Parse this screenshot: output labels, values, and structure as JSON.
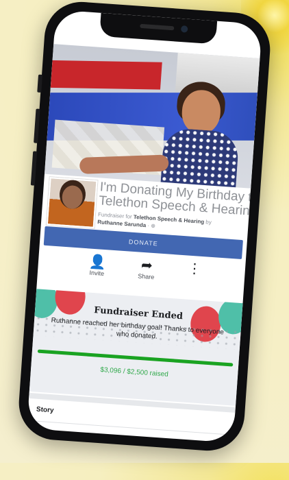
{
  "fundraiser": {
    "title": "I'm Donating My Birthday to Telethon Speech & Hearing",
    "subline_prefix": "Fundraiser for",
    "beneficiary": "Telethon Speech & Hearing",
    "by": "by",
    "organizer": "Ruthanne Sarunda",
    "donate_label": "DONATE"
  },
  "actions": [
    {
      "label": "Invite",
      "icon": "add-friend-icon"
    },
    {
      "label": "Share",
      "icon": "share-icon"
    },
    {
      "label": "",
      "icon": "more-icon"
    }
  ],
  "ended": {
    "title": "Fundraiser Ended",
    "message": "Ruthanne reached her birthday goal! Thanks to everyone who donated.",
    "progress_fraction": 1.0,
    "raised_text": "$3,096 / $2,500 raised"
  },
  "story": {
    "label": "Story"
  },
  "colors": {
    "donate": "#4267b2",
    "progress": "#1aa322",
    "raised": "#2fa84a"
  }
}
